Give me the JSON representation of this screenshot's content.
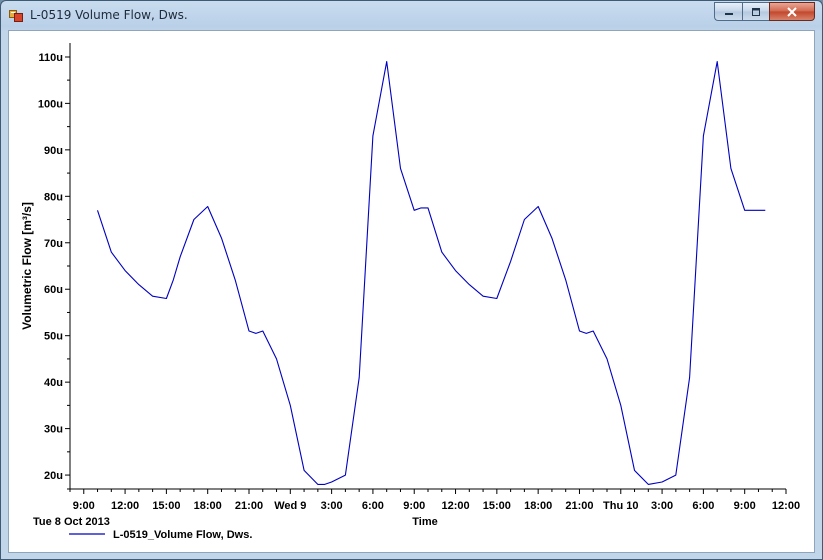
{
  "window": {
    "title": "L-0519 Volume Flow, Dws.",
    "icon": "app-chart-icon",
    "controls": [
      "minimize-icon",
      "maximize-icon",
      "close-icon"
    ]
  },
  "chart_data": {
    "type": "line",
    "title": "",
    "xlabel": "Time",
    "ylabel": "Volumetric Flow [m³/s]",
    "x_tick_labels": [
      "9:00",
      "12:00",
      "15:00",
      "18:00",
      "21:00",
      "Wed 9",
      "3:00",
      "6:00",
      "9:00",
      "12:00",
      "15:00",
      "18:00",
      "21:00",
      "Thu 10",
      "3:00",
      "6:00",
      "9:00",
      "12:00"
    ],
    "x_range_hours": [
      8,
      60
    ],
    "date_label": "Tue 8 Oct 2013",
    "y_tick_labels": [
      "20u",
      "30u",
      "40u",
      "50u",
      "60u",
      "70u",
      "80u",
      "90u",
      "100u",
      "110u"
    ],
    "ylim": [
      17,
      113
    ],
    "grid": false,
    "legend_position": "bottom-left",
    "series": [
      {
        "name": "L-0519_Volume Flow, Dws.",
        "color": "#0000c0",
        "x_hours": [
          10,
          11,
          12,
          13,
          14,
          15,
          15.5,
          16,
          17,
          18,
          19,
          20,
          21,
          21.5,
          22,
          23,
          24,
          25,
          26,
          26.5,
          27,
          28,
          29,
          30,
          31,
          32,
          33,
          33.5,
          34,
          35,
          36,
          37,
          38,
          39,
          39.5,
          40,
          41,
          42,
          43,
          44,
          45,
          45.5,
          46,
          47,
          48,
          49,
          50,
          51,
          52,
          53,
          54,
          55,
          56,
          57,
          58,
          58.5
        ],
        "values": [
          77,
          68,
          64,
          61,
          58.5,
          58,
          62,
          67,
          75,
          77.8,
          71,
          62,
          51,
          50.5,
          51,
          45,
          35,
          21,
          18,
          18,
          18.5,
          20,
          41,
          93,
          109,
          86,
          77,
          77.5,
          77.5,
          68,
          64,
          61,
          58.5,
          58,
          62,
          66,
          75,
          77.8,
          71,
          62,
          51,
          50.5,
          51,
          45,
          35,
          21,
          18,
          18.5,
          20,
          41,
          93,
          109,
          86,
          77,
          77,
          77
        ]
      }
    ]
  }
}
